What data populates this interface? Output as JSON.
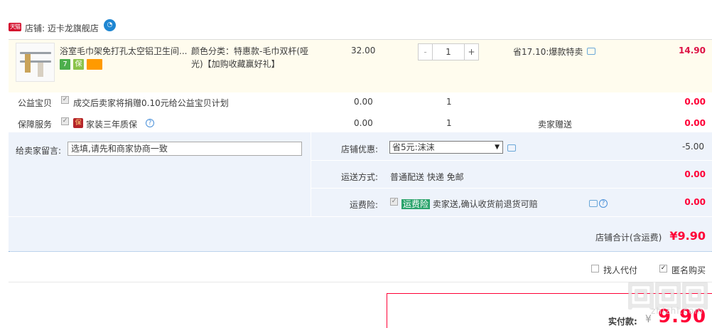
{
  "shop": {
    "badge": "天猫",
    "label": "店铺: 迈卡龙旗舰店"
  },
  "item": {
    "title": "浴室毛巾架免打孔太空铝卫生间...",
    "service_icons": [
      "7",
      "保"
    ],
    "spec_line1": "颜色分类：特惠款-毛巾双杆(哑",
    "spec_line2": "光)【加购收藏赢好礼】",
    "price": "32.00",
    "qty_minus": "-",
    "qty_value": "1",
    "qty_plus": "+",
    "promo": "省17.10:爆款特卖",
    "subtotal": "14.90"
  },
  "charity": {
    "label": "公益宝贝",
    "text": "成交后卖家将捐赠0.10元给公益宝贝计划",
    "price": "0.00",
    "qty": "1",
    "subtotal": "0.00"
  },
  "guarantee": {
    "label": "保障服务",
    "icon_text": "保",
    "text": "家装三年质保",
    "price": "0.00",
    "qty": "1",
    "note": "卖家赠送",
    "subtotal": "0.00"
  },
  "message": {
    "label": "给卖家留言:",
    "placeholder": "选填,请先和商家协商一致"
  },
  "discount": {
    "label": "店铺优惠:",
    "selected": "省5元:沫沫",
    "amount": "-5.00"
  },
  "shipping": {
    "label": "运送方式:",
    "text": "普通配送 快递 免邮",
    "amount": "0.00"
  },
  "insurance": {
    "label": "运费险:",
    "tag": "运费险",
    "text": "卖家送,确认收货前退货可赔",
    "amount": "0.00"
  },
  "shop_total": {
    "label": "店铺合计(含运费)",
    "amount": "¥9.90"
  },
  "options": {
    "proxy_pay": "找人代付",
    "anonymous": "匿名购买"
  },
  "payment": {
    "label": "实付款:",
    "yen": "¥",
    "amount": "9.90"
  },
  "watermark": {
    "domain": "zhizhi.com"
  },
  "colors": {
    "price_red": "#ff0036",
    "panel_blue": "#eef3fb",
    "item_bg": "#fffcee",
    "insurance_green": "#2aa36b"
  }
}
